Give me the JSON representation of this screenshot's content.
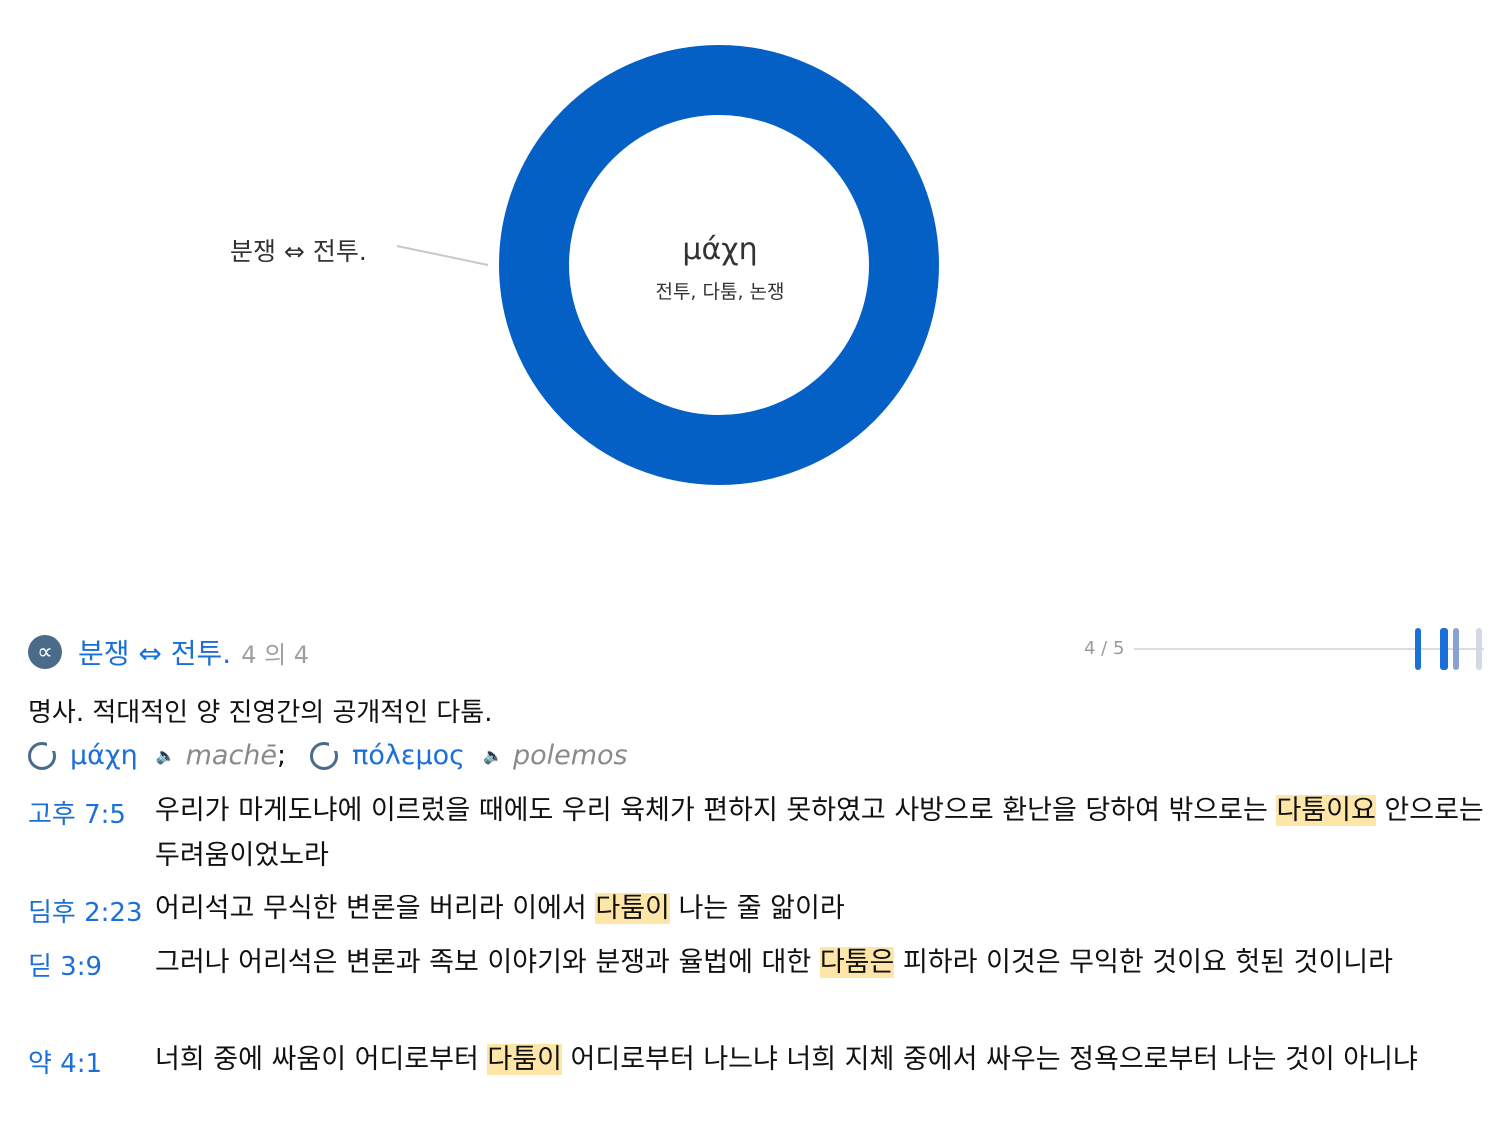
{
  "chart_data": {
    "type": "pie",
    "style": "donut",
    "center_title": "μάχη",
    "center_subtitle": "전투, 다툼, 논쟁",
    "slices": [
      {
        "label": "분쟁 ⇔ 전투.",
        "value": 100,
        "color": "#0560c6"
      }
    ]
  },
  "sense": {
    "icon": "∝",
    "title": "분쟁 ⇔ 전투.",
    "count": "4 의 4",
    "pager": "4 / 5"
  },
  "definition": "명사. 적대적인 양 진영간의 공개적인 다툼.",
  "lemmas": [
    {
      "greek": "μάχη",
      "translit": "machē",
      "separator": ";"
    },
    {
      "greek": "πόλεμος",
      "translit": "polemos",
      "separator": ""
    }
  ],
  "verses": [
    {
      "ref": "고후 7:5",
      "before": "우리가 마게도냐에 이르렀을 때에도 우리 육체가 편하지 못하였고 사방으로 환난을 당하여 밖으로는 ",
      "highlight": "다툼이요",
      "after": " 안으로는 두려움이었노라"
    },
    {
      "ref": "딤후 2:23",
      "before": "어리석고 무식한 변론을 버리라 이에서 ",
      "highlight": "다툼이",
      "after": " 나는 줄 앎이라"
    },
    {
      "ref": "딛 3:9",
      "before": "그러나 어리석은 변론과 족보 이야기와 분쟁과 율법에 대한 ",
      "highlight": "다툼은",
      "after": " 피하라 이것은 무익한 것이요 헛된 것이니라"
    },
    {
      "ref": "약 4:1",
      "before": "너희 중에 싸움이 어디로부터 ",
      "highlight": "다툼이",
      "after": " 어디로부터 나느냐 너희 지체 중에서 싸우는 정욕으로부터 나는 것이 아니냐"
    }
  ],
  "colors": {
    "link": "#1a6fd8",
    "donut": "#0560c6",
    "highlight": "#fde6a8",
    "muted": "#9a9a9a"
  },
  "icons": {
    "sense": "proportional-icon",
    "lemma": "refresh-icon",
    "audio": "speaker-icon"
  }
}
